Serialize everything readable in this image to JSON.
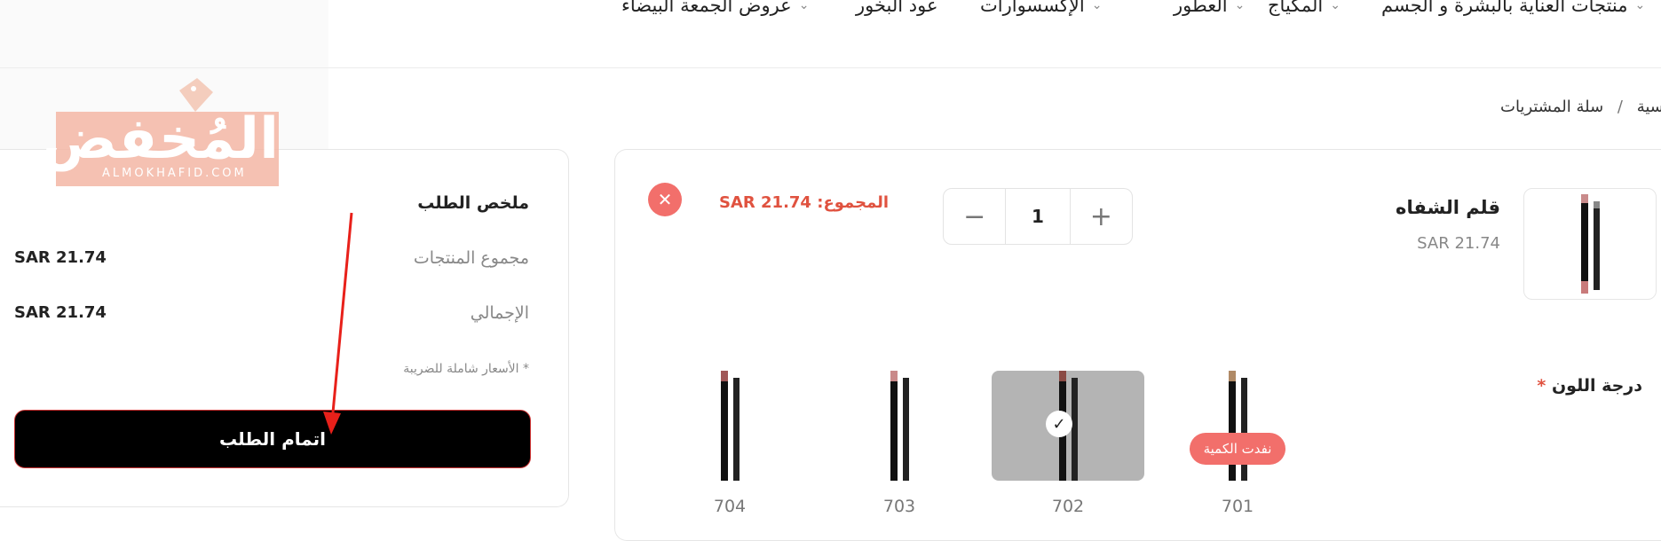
{
  "nav": {
    "items": [
      {
        "label": "منتجات العناية بالبشرة و الجسم",
        "has_dropdown": true
      },
      {
        "label": "المكياج",
        "has_dropdown": true
      },
      {
        "label": "العطور",
        "has_dropdown": true
      },
      {
        "label": "الإكسسوارات",
        "has_dropdown": true
      },
      {
        "label": "عود البخور",
        "has_dropdown": false
      },
      {
        "label": "عروض الجمعة البيضاء",
        "has_dropdown": true
      }
    ]
  },
  "breadcrumb": {
    "home": "الرئيسية",
    "separator": "/",
    "current": "سلة المشتريات"
  },
  "logo": {
    "text": "المُخفض",
    "subtext": "ALMOKHAFID.COM"
  },
  "summary": {
    "title": "ملخص الطلب",
    "subtotal_label": "مجموع المنتجات",
    "subtotal_value": "SAR 21.74",
    "total_label": "الإجمالي",
    "total_value": "SAR 21.74",
    "tax_note": "* الأسعار شاملة للضريبة",
    "checkout_label": "اتمام الطلب"
  },
  "cart_item": {
    "name": "قلم الشفاه",
    "price": "SAR 21.74",
    "total_label": "المجموع:",
    "total_value": "SAR 21.74",
    "quantity": "1",
    "shade_label": "درجة اللون",
    "required_mark": "*",
    "shades": [
      {
        "code": "701",
        "selected": false,
        "status": "نفدت الكمية"
      },
      {
        "code": "702",
        "selected": true,
        "status": ""
      },
      {
        "code": "703",
        "selected": false,
        "status": ""
      },
      {
        "code": "704",
        "selected": false,
        "status": ""
      }
    ]
  },
  "icons": {
    "close": "close-icon",
    "plus": "plus-icon",
    "minus": "minus-icon",
    "check": "check-icon",
    "chevron": "chevron-down-icon"
  },
  "colors": {
    "accent": "#e0523f",
    "close_bg": "#f26f6b",
    "checkout_bg": "#000000",
    "selected_swatch": "#b4b4b4"
  }
}
